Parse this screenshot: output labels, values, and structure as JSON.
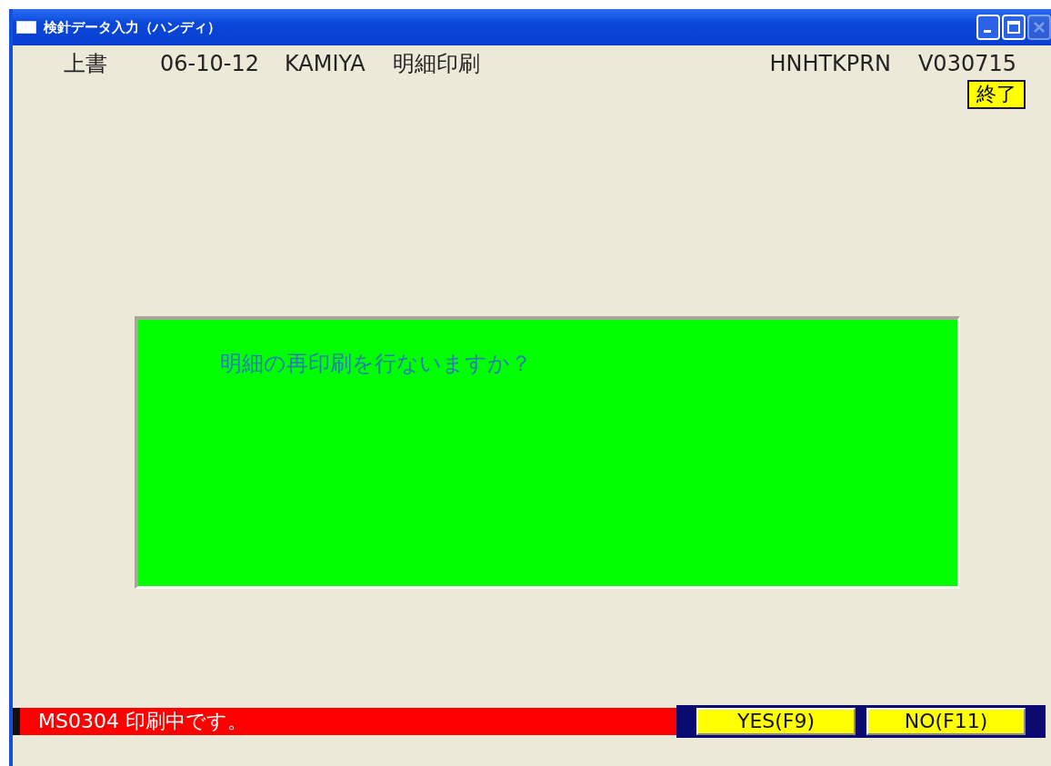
{
  "window": {
    "title": "検針データ入力（ハンディ）",
    "close_disabled": true
  },
  "header": {
    "mode": "上書",
    "date": "06-10-12",
    "user": "KAMIYA",
    "function": "明細印刷",
    "program": "HNHTKPRN",
    "version": "V030715"
  },
  "exit_button": "終了",
  "dialog": {
    "message": "明細の再印刷を行ないますか？"
  },
  "status_bar": {
    "message": "MS0304 印刷中です。"
  },
  "buttons": [
    "YES(F9)",
    "NO(F11)"
  ]
}
